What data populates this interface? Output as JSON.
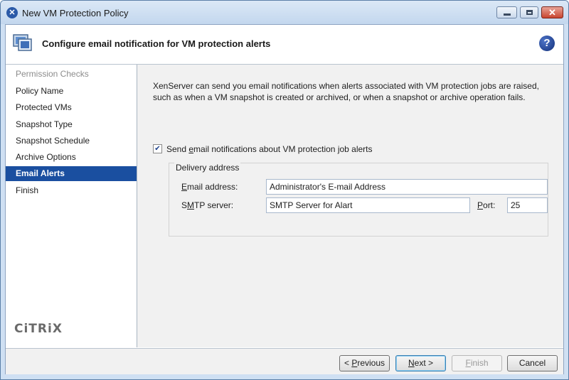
{
  "window": {
    "title": "New VM Protection Policy"
  },
  "header": {
    "title": "Configure email notification for VM protection alerts"
  },
  "nav": {
    "items": [
      {
        "label": "Permission Checks",
        "state": "disabled"
      },
      {
        "label": "Policy Name",
        "state": "normal"
      },
      {
        "label": "Protected VMs",
        "state": "normal"
      },
      {
        "label": "Snapshot Type",
        "state": "normal"
      },
      {
        "label": "Snapshot Schedule",
        "state": "normal"
      },
      {
        "label": "Archive Options",
        "state": "normal"
      },
      {
        "label": "Email Alerts",
        "state": "selected"
      },
      {
        "label": "Finish",
        "state": "normal"
      }
    ]
  },
  "brand": {
    "logo_text": "CiTRiX"
  },
  "content": {
    "description": "XenServer can send you email notifications when alerts associated with VM protection jobs are raised, such as when a VM snapshot is created or archived, or when a snapshot or archive operation fails.",
    "send_checkbox": {
      "checked": true,
      "label_pre": "Send ",
      "label_key": "e",
      "label_post": "mail notifications about VM protection job alerts"
    },
    "delivery_group": "Delivery address",
    "email": {
      "label_key": "E",
      "label_rest": "mail address:",
      "value": "Administrator's E-mail Address"
    },
    "smtp": {
      "label_pre": "S",
      "label_key": "M",
      "label_post": "TP server:",
      "value": "SMTP Server for Alart"
    },
    "port": {
      "label_key": "P",
      "label_rest": "ort:",
      "value": "25"
    }
  },
  "footer": {
    "previous": {
      "pre": "< ",
      "key": "P",
      "rest": "revious"
    },
    "next": {
      "key": "N",
      "rest": "ext >"
    },
    "finish": {
      "key": "F",
      "rest": "inish"
    },
    "cancel": "Cancel"
  },
  "colors": {
    "selection": "#1a4fa0",
    "titlebar": "#c3d7ee",
    "close": "#c9452f"
  }
}
